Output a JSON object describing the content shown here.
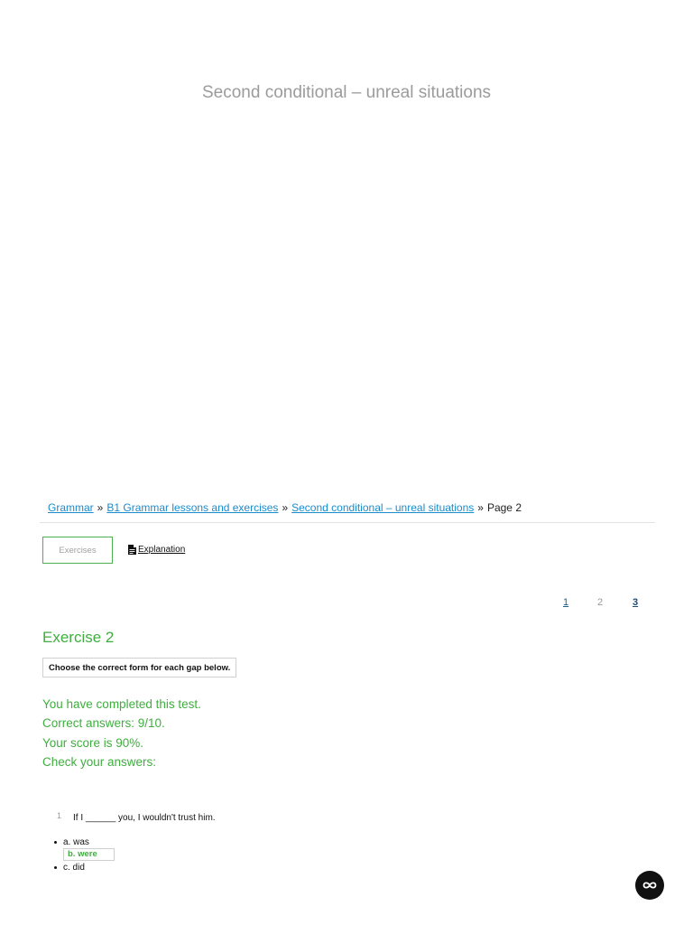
{
  "page_title": "Second conditional – unreal situations",
  "breadcrumb": {
    "items": [
      {
        "label": "Grammar"
      },
      {
        "label": "B1 Grammar lessons and exercises"
      },
      {
        "label": "Second conditional – unreal situations"
      }
    ],
    "separator": "»",
    "current": "Page 2"
  },
  "tabs": {
    "exercises": "Exercises",
    "explanation": "Explanation"
  },
  "pagination": [
    "1",
    "2",
    "3"
  ],
  "exercise": {
    "title": "Exercise 2",
    "instruction": "Choose the correct form for each gap below."
  },
  "results": {
    "completed": "You have completed this test.",
    "correct": "Correct answers: 9/10.",
    "score": "Your score is 90%.",
    "check": "Check your answers:"
  },
  "question": {
    "number": "1",
    "text": "If I ______ you, I wouldn't trust him.",
    "options": [
      {
        "label": "a. was"
      },
      {
        "label": "b. were"
      },
      {
        "label": "c. did"
      }
    ]
  },
  "icons": {
    "explanation": "document-icon",
    "fab": "infinity-icon"
  },
  "colors": {
    "accent_green": "#3fae3f",
    "link_blue": "#1a8ccc"
  }
}
